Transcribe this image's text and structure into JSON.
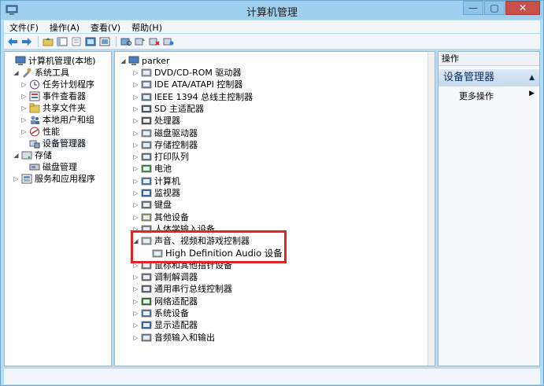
{
  "window": {
    "title": "计算机管理",
    "controls": {
      "minimize": "—",
      "maximize": "▢",
      "close": "✕"
    }
  },
  "menu": [
    "文件(F)",
    "操作(A)",
    "查看(V)",
    "帮助(H)"
  ],
  "left_tree": [
    {
      "label": "计算机管理(本地)",
      "icon": "computer-management-icon",
      "level": 0,
      "expander": ""
    },
    {
      "label": "系统工具",
      "icon": "system-tools-icon",
      "level": 1,
      "expander": "◢"
    },
    {
      "label": "任务计划程序",
      "icon": "task-scheduler-icon",
      "level": 2,
      "expander": "▷"
    },
    {
      "label": "事件查看器",
      "icon": "event-viewer-icon",
      "level": 2,
      "expander": "▷"
    },
    {
      "label": "共享文件夹",
      "icon": "shared-folders-icon",
      "level": 2,
      "expander": "▷"
    },
    {
      "label": "本地用户和组",
      "icon": "local-users-icon",
      "level": 2,
      "expander": "▷"
    },
    {
      "label": "性能",
      "icon": "performance-icon",
      "level": 2,
      "expander": "▷"
    },
    {
      "label": "设备管理器",
      "icon": "device-manager-icon",
      "level": 2,
      "expander": "",
      "selected": true
    },
    {
      "label": "存储",
      "icon": "storage-icon",
      "level": 1,
      "expander": "◢"
    },
    {
      "label": "磁盘管理",
      "icon": "disk-management-icon",
      "level": 2,
      "expander": ""
    },
    {
      "label": "服务和应用程序",
      "icon": "services-apps-icon",
      "level": 1,
      "expander": "▷"
    }
  ],
  "device_tree": {
    "root": {
      "label": "parker",
      "icon": "computer-icon",
      "expander": "◢"
    },
    "categories": [
      {
        "label": "DVD/CD-ROM 驱动器",
        "icon": "dvd-drive-icon"
      },
      {
        "label": "IDE ATA/ATAPI 控制器",
        "icon": "ide-controller-icon"
      },
      {
        "label": "IEEE 1394 总线主控制器",
        "icon": "ieee1394-icon"
      },
      {
        "label": "SD 主适配器",
        "icon": "sd-adapter-icon"
      },
      {
        "label": "处理器",
        "icon": "processor-icon"
      },
      {
        "label": "磁盘驱动器",
        "icon": "disk-drive-icon"
      },
      {
        "label": "存储控制器",
        "icon": "storage-controller-icon"
      },
      {
        "label": "打印队列",
        "icon": "print-queue-icon"
      },
      {
        "label": "电池",
        "icon": "battery-icon"
      },
      {
        "label": "计算机",
        "icon": "computer-icon"
      },
      {
        "label": "监视器",
        "icon": "monitor-icon"
      },
      {
        "label": "键盘",
        "icon": "keyboard-icon"
      },
      {
        "label": "其他设备",
        "icon": "other-devices-icon"
      },
      {
        "label": "人体学输入设备",
        "icon": "hid-icon"
      },
      {
        "label": "声音、视频和游戏控制器",
        "icon": "sound-icon",
        "expanded": true
      },
      {
        "label": "High Definition Audio 设备",
        "icon": "audio-device-icon",
        "child": true
      },
      {
        "label": "鼠标和其他指针设备",
        "icon": "mouse-icon"
      },
      {
        "label": "调制解调器",
        "icon": "modem-icon"
      },
      {
        "label": "通用串行总线控制器",
        "icon": "usb-icon"
      },
      {
        "label": "网络适配器",
        "icon": "network-adapter-icon"
      },
      {
        "label": "系统设备",
        "icon": "system-devices-icon"
      },
      {
        "label": "显示适配器",
        "icon": "display-adapter-icon"
      },
      {
        "label": "音频输入和输出",
        "icon": "audio-io-icon"
      }
    ]
  },
  "actions": {
    "header": "操作",
    "section": "设备管理器",
    "more": "更多操作",
    "section_arrow": "▲",
    "more_arrow": "▶"
  },
  "colors": {
    "highlight": "#e02525",
    "close": "#c7504b"
  }
}
